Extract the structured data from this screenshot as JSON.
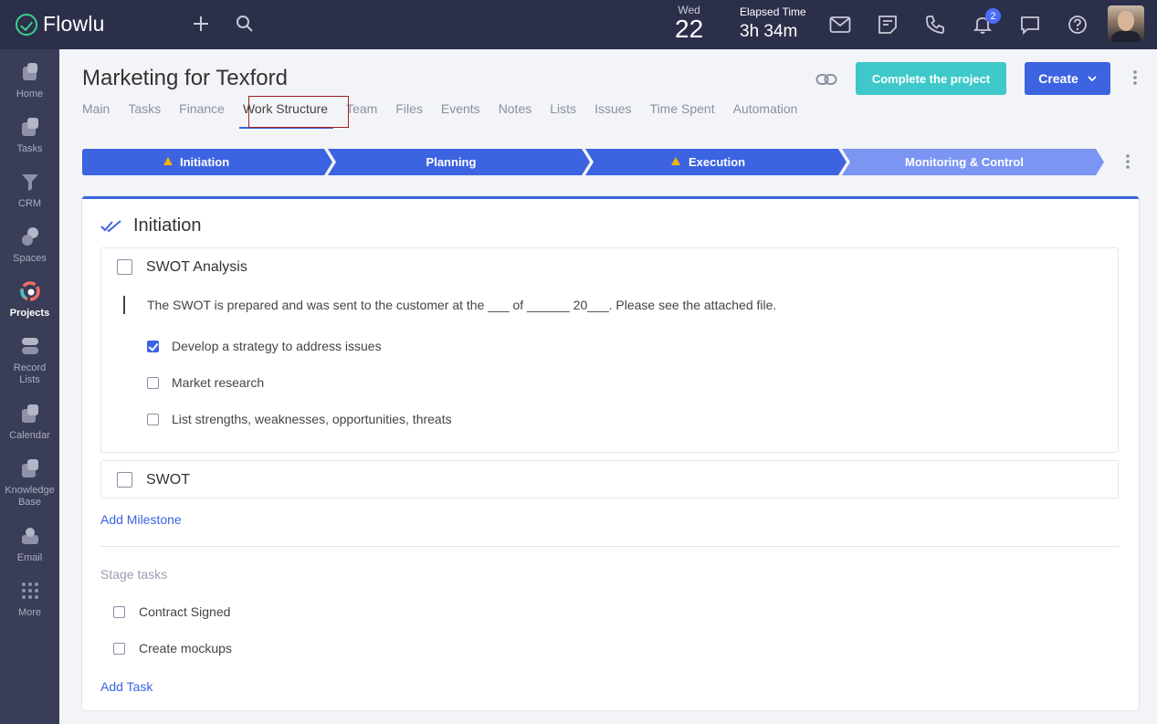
{
  "app": {
    "name": "Flowlu"
  },
  "topbar": {
    "date_dow": "Wed",
    "date_day": "22",
    "elapsed_label": "Elapsed Time",
    "elapsed_value": "3h 34m",
    "notifications_count": "2"
  },
  "sidebar": {
    "items": [
      {
        "label": "Home",
        "icon": "home-icon"
      },
      {
        "label": "Tasks",
        "icon": "tasks-icon"
      },
      {
        "label": "CRM",
        "icon": "crm-icon"
      },
      {
        "label": "Spaces",
        "icon": "spaces-icon"
      },
      {
        "label": "Projects",
        "icon": "projects-icon",
        "active": true
      },
      {
        "label": "Record Lists",
        "icon": "record-lists-icon"
      },
      {
        "label": "Calendar",
        "icon": "calendar-icon"
      },
      {
        "label": "Knowledge Base",
        "icon": "knowledge-base-icon"
      },
      {
        "label": "Email",
        "icon": "email-icon"
      },
      {
        "label": "More",
        "icon": "more-grid-icon"
      }
    ]
  },
  "header": {
    "title": "Marketing for Texford",
    "complete_label": "Complete the project",
    "create_label": "Create"
  },
  "tabs": [
    {
      "label": "Main"
    },
    {
      "label": "Tasks"
    },
    {
      "label": "Finance"
    },
    {
      "label": "Work Structure",
      "active": true
    },
    {
      "label": "Team"
    },
    {
      "label": "Files"
    },
    {
      "label": "Events"
    },
    {
      "label": "Notes"
    },
    {
      "label": "Lists"
    },
    {
      "label": "Issues"
    },
    {
      "label": "Time Spent"
    },
    {
      "label": "Automation"
    }
  ],
  "stages": [
    {
      "label": "Initiation",
      "warning": true
    },
    {
      "label": "Planning",
      "warning": false
    },
    {
      "label": "Execution",
      "warning": true
    },
    {
      "label": "Monitoring & Control",
      "warning": false
    }
  ],
  "colors": {
    "stage_active": "#3c63e0",
    "stage_inactive": "#7b95f3",
    "warning": "#f5b400",
    "accent_teal": "#3fc8c9"
  },
  "section": {
    "title": "Initiation",
    "milestones": [
      {
        "title": "SWOT Analysis",
        "checked": false,
        "description": "The SWOT is prepared and was sent to the customer at the ___ of ______ 20___. Please see the attached file.",
        "subtasks": [
          {
            "label": "Develop a strategy to address issues",
            "checked": true
          },
          {
            "label": "Market research",
            "checked": false
          },
          {
            "label": "List strengths, weaknesses, opportunities, threats",
            "checked": false
          }
        ]
      },
      {
        "title": "SWOT",
        "checked": false
      }
    ],
    "add_milestone_label": "Add Milestone",
    "stage_tasks_label": "Stage tasks",
    "stage_tasks": [
      {
        "label": "Contract Signed",
        "checked": false
      },
      {
        "label": "Create mockups",
        "checked": false
      }
    ],
    "add_task_label": "Add Task"
  }
}
